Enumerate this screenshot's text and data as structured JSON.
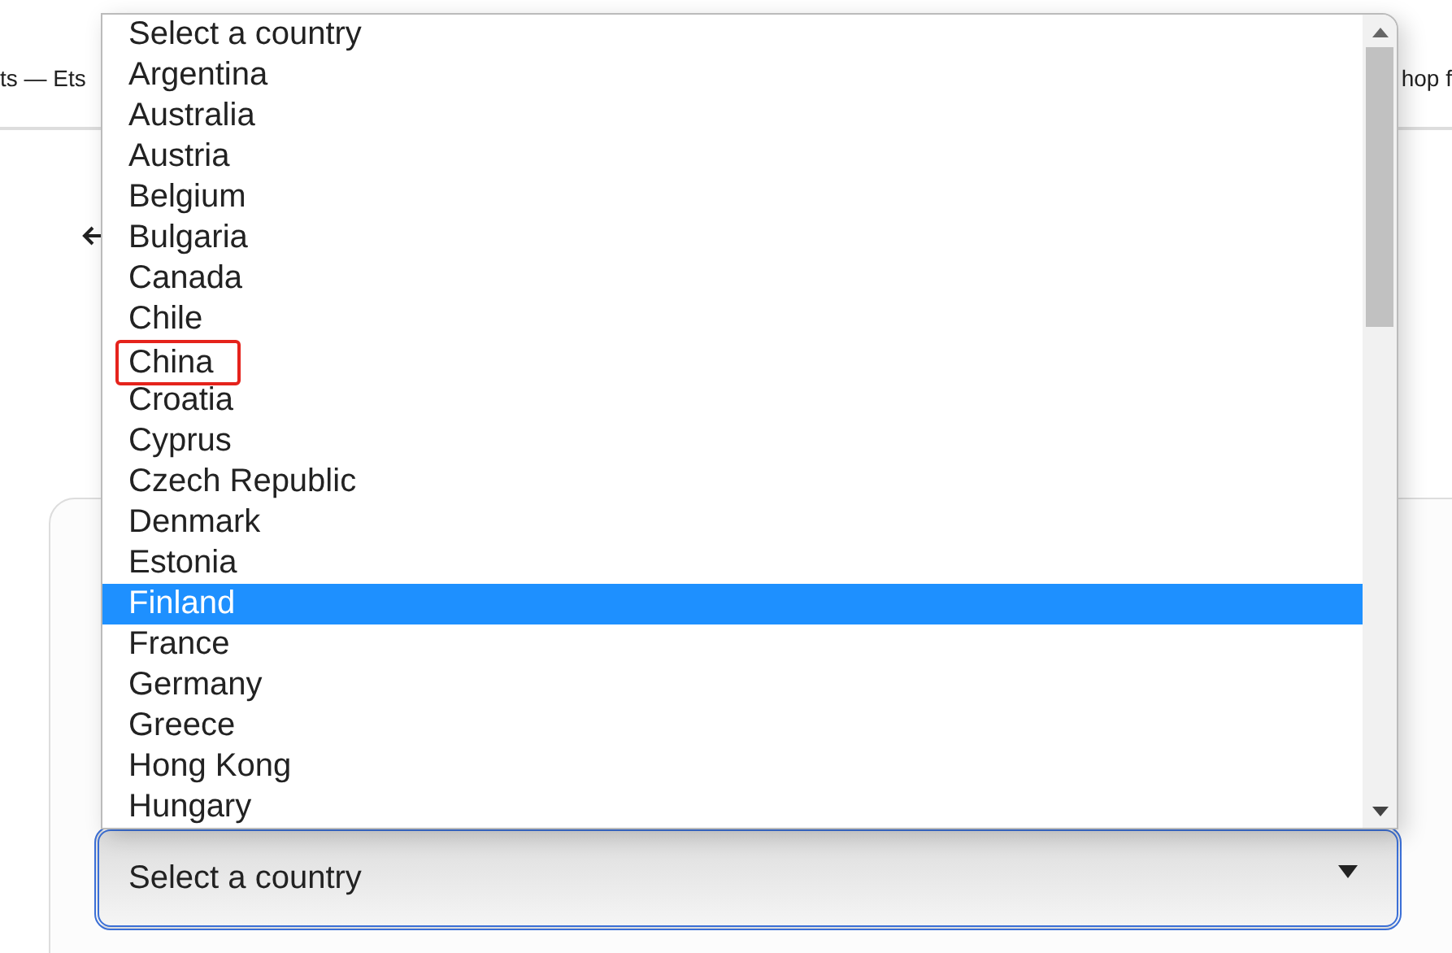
{
  "browser_bar": {
    "left_text": "ts — Ets",
    "right_text": "hop f"
  },
  "dropdown": {
    "options": [
      {
        "label": "Select a country",
        "selected": false,
        "circled": false
      },
      {
        "label": "Argentina",
        "selected": false,
        "circled": false
      },
      {
        "label": "Australia",
        "selected": false,
        "circled": false
      },
      {
        "label": "Austria",
        "selected": false,
        "circled": false
      },
      {
        "label": "Belgium",
        "selected": false,
        "circled": false
      },
      {
        "label": "Bulgaria",
        "selected": false,
        "circled": false
      },
      {
        "label": "Canada",
        "selected": false,
        "circled": false
      },
      {
        "label": "Chile",
        "selected": false,
        "circled": false
      },
      {
        "label": "China",
        "selected": false,
        "circled": true
      },
      {
        "label": "Croatia",
        "selected": false,
        "circled": false
      },
      {
        "label": "Cyprus",
        "selected": false,
        "circled": false
      },
      {
        "label": "Czech Republic",
        "selected": false,
        "circled": false
      },
      {
        "label": "Denmark",
        "selected": false,
        "circled": false
      },
      {
        "label": "Estonia",
        "selected": false,
        "circled": false
      },
      {
        "label": "Finland",
        "selected": true,
        "circled": false
      },
      {
        "label": "France",
        "selected": false,
        "circled": false
      },
      {
        "label": "Germany",
        "selected": false,
        "circled": false
      },
      {
        "label": "Greece",
        "selected": false,
        "circled": false
      },
      {
        "label": "Hong Kong",
        "selected": false,
        "circled": false
      },
      {
        "label": "Hungary",
        "selected": false,
        "circled": false
      }
    ]
  },
  "select": {
    "value": "Select a country"
  }
}
